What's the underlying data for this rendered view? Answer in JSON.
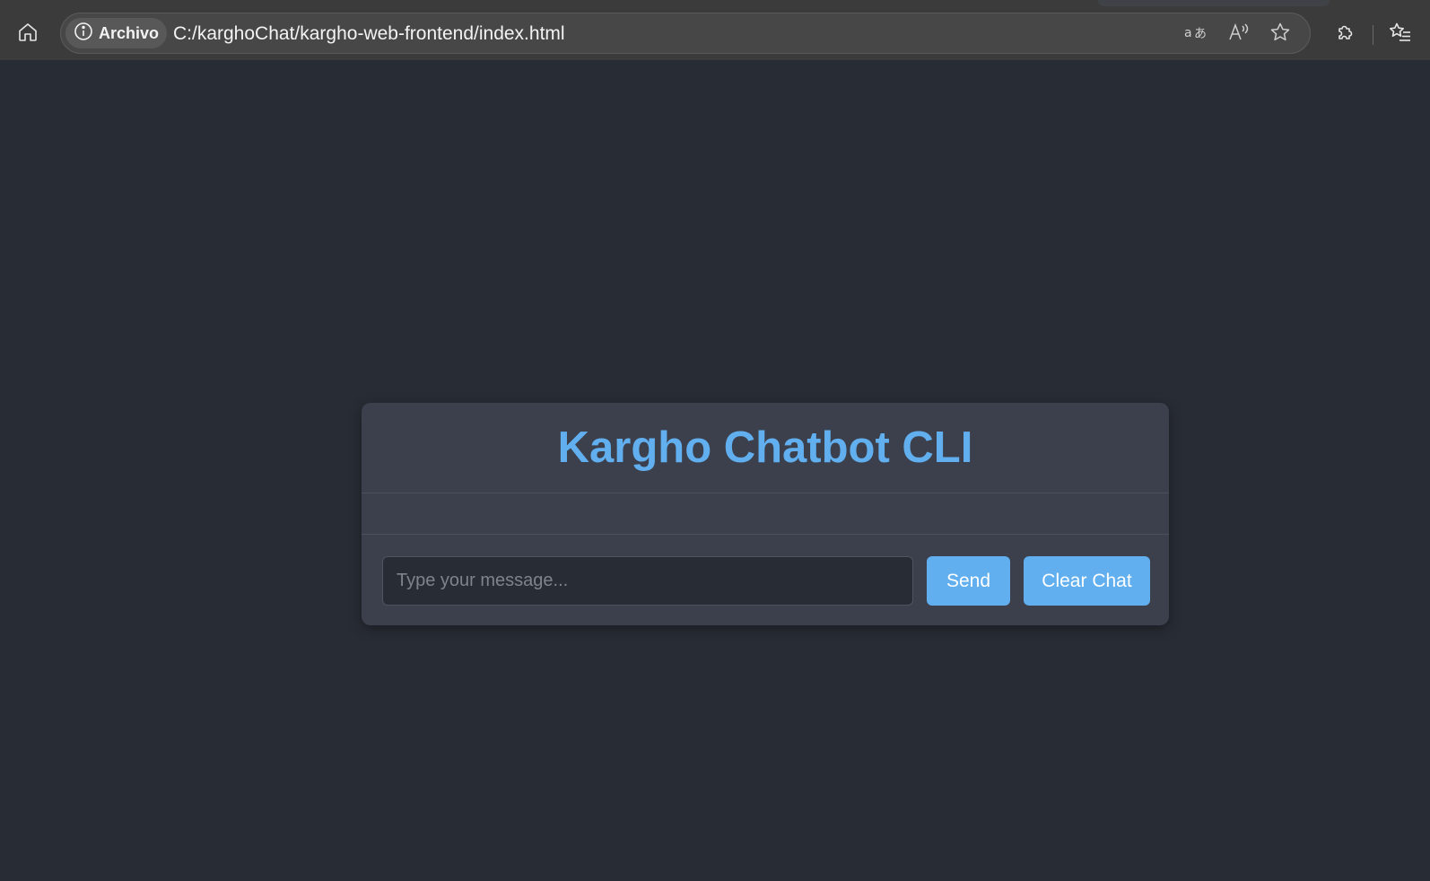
{
  "browser": {
    "site_chip_label": "Archivo",
    "url": "C:/karghoChat/kargho-web-frontend/index.html",
    "icons": {
      "home": "home-icon",
      "site_info": "info-icon",
      "translate": "translate-icon",
      "read_aloud": "read-aloud-icon",
      "favorite": "star-icon",
      "extensions": "puzzle-icon",
      "favorites": "favorites-list-icon"
    }
  },
  "page": {
    "title": "Kargho Chatbot CLI",
    "input_placeholder": "Type your message...",
    "input_value": "",
    "send_label": "Send",
    "clear_label": "Clear Chat"
  },
  "colors": {
    "background": "#282c34",
    "card": "#3c404d",
    "accent": "#61afef"
  }
}
